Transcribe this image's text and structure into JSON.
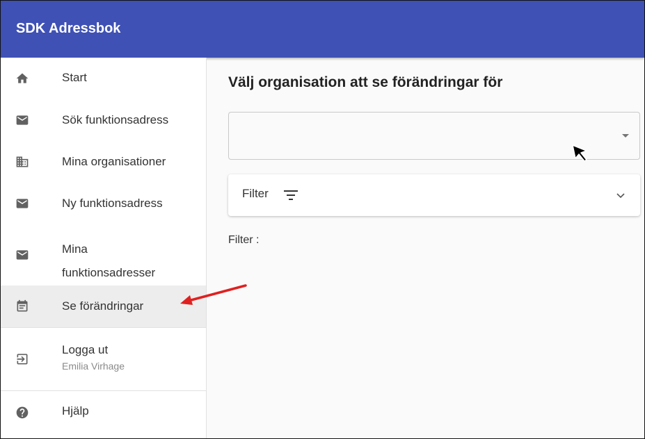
{
  "app": {
    "title": "SDK Adressbok"
  },
  "sidebar": {
    "items": [
      {
        "label": "Start",
        "icon": "home-icon"
      },
      {
        "label": "Sök funktionsadress",
        "icon": "mail-icon"
      },
      {
        "label": "Mina organisationer",
        "icon": "building-icon"
      },
      {
        "label": "Ny funktionsadress",
        "icon": "mail-icon"
      },
      {
        "label_line1": "Mina",
        "label_line2": "funktionsadresser",
        "icon": "mail-icon"
      },
      {
        "label": "Se förändringar",
        "icon": "calendar-icon",
        "active": true
      },
      {
        "label": "Logga ut",
        "sublabel": "Emilia Virhage",
        "icon": "logout-icon"
      },
      {
        "label": "Hjälp",
        "icon": "help-icon"
      }
    ]
  },
  "main": {
    "heading": "Välj organisation att se förändringar för",
    "organisation_select": {
      "value": ""
    },
    "filter_panel": {
      "label": "Filter"
    },
    "filter_summary": "Filter :"
  },
  "colors": {
    "appbar": "#3f51b5",
    "active_item": "#ededed",
    "annotation_arrow": "#e02020"
  }
}
